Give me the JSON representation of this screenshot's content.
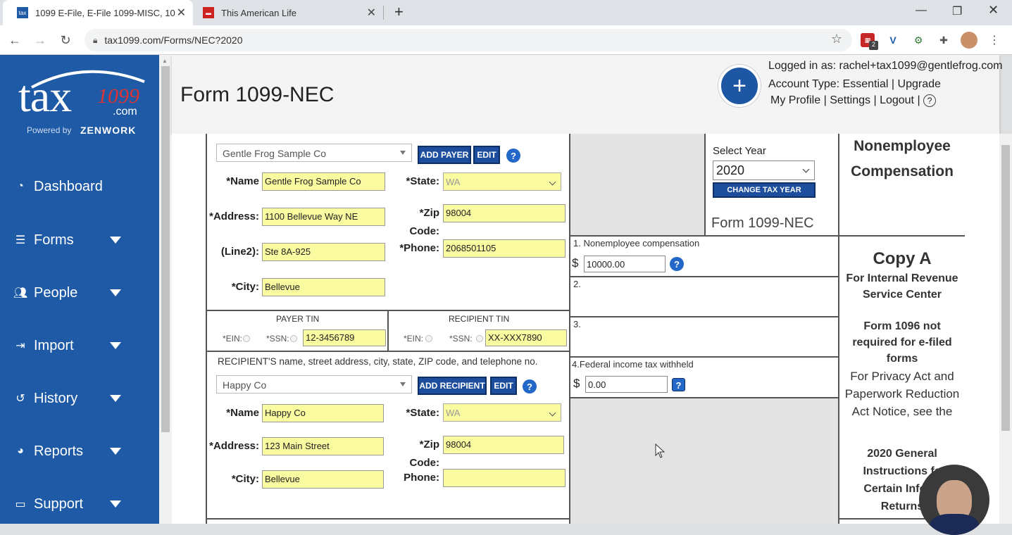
{
  "browser": {
    "tabs": [
      {
        "title": "1099 E-File, E-File 1099-MISC, 10",
        "favicon": "tax"
      },
      {
        "title": "This American Life"
      }
    ],
    "url": "tax1099.com/Forms/NEC?2020",
    "ext_badge": "2"
  },
  "sidebar": {
    "logo": {
      "tax": "tax",
      "num": "1099",
      "com": ".com",
      "powered": "Powered by",
      "brand": "ZENWORK"
    },
    "items": [
      {
        "label": "Dashboard"
      },
      {
        "label": "Forms"
      },
      {
        "label": "People"
      },
      {
        "label": "Import"
      },
      {
        "label": "History"
      },
      {
        "label": "Reports"
      },
      {
        "label": "Support"
      }
    ]
  },
  "header": {
    "title": "Form 1099-NEC",
    "plus": "+",
    "logged_in": "Logged in as: rachel+tax1099@gentlefrog.com",
    "account": "Account Type: Essential | Upgrade",
    "links": {
      "profile": "My Profile",
      "settings": "Settings",
      "logout": "Logout",
      "sep": "|",
      "help": "?"
    }
  },
  "payer": {
    "select": "Gentle Frog Sample Co",
    "add_btn": "ADD PAYER",
    "edit_btn": "EDIT",
    "labels": {
      "name": "*Name",
      "address": "*Address:",
      "line2": "(Line2):",
      "city": "*City:",
      "state": "*State:",
      "zip": "*Zip",
      "zip2": "Code:",
      "phone": "*Phone:"
    },
    "name": "Gentle Frog Sample Co",
    "address": "1100 Bellevue Way NE",
    "line2": "Ste 8A-925",
    "city": "Bellevue",
    "state": "WA",
    "zip": "98004",
    "phone": "2068501105"
  },
  "tin": {
    "payer_title": "PAYER TIN",
    "recipient_title": "RECIPIENT TIN",
    "ein": "*EIN:",
    "ssn": "*SSN:",
    "payer_value": "12-3456789",
    "recipient_value": "XX-XXX7890"
  },
  "recipient": {
    "heading": "RECIPIENT'S name, street address, city, state, ZIP code, and telephone no.",
    "select": "Happy Co",
    "add_btn": "ADD RECIPIENT",
    "edit_btn": "EDIT",
    "labels": {
      "name": "*Name",
      "address": "*Address:",
      "city": "*City:",
      "state": "*State:",
      "zip": "*Zip",
      "zip2": "Code:",
      "phone": "Phone:"
    },
    "name": "Happy Co",
    "address": "123 Main Street",
    "city": "Bellevue",
    "state": "WA",
    "zip": "98004",
    "phone": ""
  },
  "year": {
    "label": "Select Year",
    "value": "2020",
    "change_btn": "CHANGE TAX YEAR",
    "form_name": "Form 1099-NEC"
  },
  "boxes": {
    "box1_label": "1. Nonemployee compensation",
    "currency": "$",
    "box1_value": "10000.00",
    "box2_label": "2.",
    "box3_label": "3.",
    "box4_label": "4.Federal income tax withheld",
    "box4_value": "0.00"
  },
  "right_panel": {
    "title1": "Nonemployee",
    "title2": "Compensation",
    "copy": "Copy A",
    "irs1": "For Internal Revenue",
    "irs2": "Service Center",
    "f1096_1": "Form 1096 not",
    "f1096_2": "required for e-filed",
    "f1096_3": "forms",
    "privacy1": "For Privacy Act and",
    "privacy2": "Paperwork Reduction",
    "privacy3": "Act Notice, see the",
    "gen1": "2020 General",
    "gen2": "Instructions fo",
    "gen3": "Certain Inform",
    "gen4": "Returns"
  },
  "colors": {
    "sidebar": "#1f5aa6",
    "field_yellow": "#fafaa0",
    "button": "#1d4e9e"
  }
}
